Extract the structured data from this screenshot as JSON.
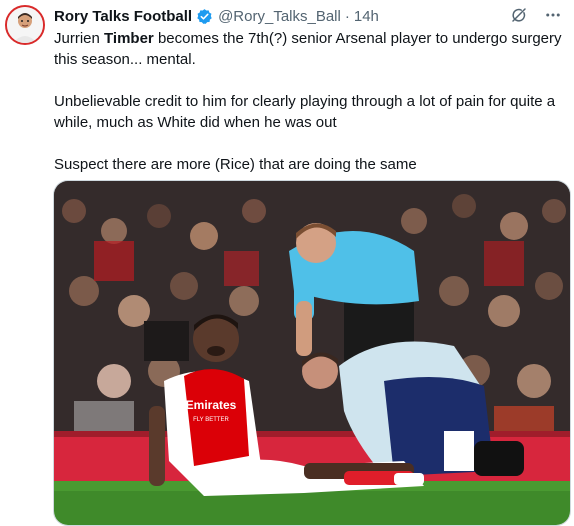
{
  "tweet": {
    "display_name": "Rory Talks Football",
    "handle": "@Rory_Talks_Ball",
    "separator": "·",
    "time": "14h",
    "text": {
      "l1_pre": "Jurrien ",
      "l1_bold": "Timber",
      "l1_post": " becomes the 7th(?) senior Arsenal player to undergo surgery this season... mental.",
      "para2": "Unbelievable credit to him for clearly playing through a lot of pain for quite a while, much as White did when he was out",
      "para3": "Suspect there are more (Rice) that are doing the same"
    },
    "media": {
      "shirt_sponsor_line1": "Emirates",
      "shirt_sponsor_line2": "FLY BETTER"
    }
  },
  "icons": {
    "avatar": "profile-avatar",
    "verified": "verified-badge-icon",
    "grok": "grok-icon",
    "more": "more-icon"
  },
  "colors": {
    "verified_blue": "#1d9bf0",
    "text_primary": "#0f1419",
    "text_secondary": "#536471",
    "arsenal_red": "#db0007",
    "referee_blue": "#4fc0e8",
    "pitch_green": "#3f8a2a"
  }
}
